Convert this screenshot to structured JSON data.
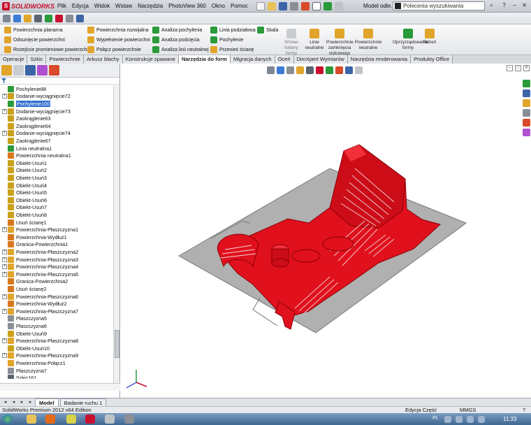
{
  "app": {
    "logo_text": "SOLIDWORKS",
    "document_name": "Model odle...",
    "search_placeholder": "Polecenia wyszukiwania"
  },
  "menu": [
    "Plik",
    "Edycja",
    "Widok",
    "Wstaw",
    "Narzędzia",
    "PhotoView 360",
    "Okno",
    "Pomoc"
  ],
  "ribbon": {
    "col1": [
      "Powierzchnia planarna",
      "Odsunięcie powierzchni",
      "Rozejście promieniowe powierzchni"
    ],
    "col2": [
      "Powierzchnia rozwijalna",
      "Wypełnienie powierzchni",
      "Połącz powierzchnie"
    ],
    "col3": [
      "Analiza pochylenia",
      "Analiza podcięcia",
      "Analiza linii neutralnej"
    ],
    "col4": [
      "Linia podziałowa",
      "Pochylenie",
      "Przenieś ścianę"
    ],
    "skala": "Skala",
    "big": [
      {
        "label": "Wstaw foldery formy"
      },
      {
        "label": "Linie neutralne"
      },
      {
        "label": "Powierzchnie zamknięcia stykowego"
      },
      {
        "label": "Powierzchnie neutralne"
      },
      {
        "label": "Oprzyrządowanie formy"
      },
      {
        "label": "Rdzeń"
      }
    ]
  },
  "tabs": [
    "Operacje",
    "Szkic",
    "Powierzchnie",
    "Arkusz blachy",
    "Konstrukcje spawane",
    "Narzędzia do form",
    "Migracja danych",
    "Oceń",
    "DimXpert Wymiarów",
    "Narzędzia renderowania",
    "Produkty Office"
  ],
  "active_tab_index": 5,
  "tree": [
    {
      "label": "Pochylenie88",
      "expandable": false,
      "icon": "draft-icon",
      "color": "#2a9a3a"
    },
    {
      "label": "Dodanie-wyciągnięcie72",
      "expandable": true,
      "icon": "extrude-icon",
      "color": "#c9a11a"
    },
    {
      "label": "Pochylenie100",
      "expandable": false,
      "icon": "draft-icon",
      "color": "#2a9a3a",
      "selected": true
    },
    {
      "label": "Dodanie-wyciągnięcie73",
      "expandable": true,
      "icon": "extrude-icon",
      "color": "#c9a11a"
    },
    {
      "label": "Zaokrąglenie63",
      "expandable": false,
      "icon": "fillet-icon",
      "color": "#c9a11a"
    },
    {
      "label": "Zaokrąglenie64",
      "expandable": false,
      "icon": "fillet-icon",
      "color": "#c9a11a"
    },
    {
      "label": "Dodanie-wyciągnięcie74",
      "expandable": true,
      "icon": "extrude-icon",
      "color": "#c9a11a"
    },
    {
      "label": "Zaokrąglenie67",
      "expandable": false,
      "icon": "fillet-icon",
      "color": "#c9a11a"
    },
    {
      "label": "Linia neutralna1",
      "expandable": false,
      "icon": "parting-line-icon",
      "color": "#2a9a3a"
    },
    {
      "label": "Powierzchnia neutralna1",
      "expandable": false,
      "icon": "parting-surface-icon",
      "color": "#d9771c"
    },
    {
      "label": "Obiekt-Usuń1",
      "expandable": false,
      "icon": "delete-body-icon",
      "color": "#c9a11a"
    },
    {
      "label": "Obiekt-Usuń2",
      "expandable": false,
      "icon": "delete-body-icon",
      "color": "#c9a11a"
    },
    {
      "label": "Obiekt-Usuń3",
      "expandable": false,
      "icon": "delete-body-icon",
      "color": "#c9a11a"
    },
    {
      "label": "Obiekt-Usuń4",
      "expandable": false,
      "icon": "delete-body-icon",
      "color": "#c9a11a"
    },
    {
      "label": "Obiekt-Usuń5",
      "expandable": false,
      "icon": "delete-body-icon",
      "color": "#c9a11a"
    },
    {
      "label": "Obiekt-Usuń6",
      "expandable": false,
      "icon": "delete-body-icon",
      "color": "#c9a11a"
    },
    {
      "label": "Obiekt-Usuń7",
      "expandable": false,
      "icon": "delete-body-icon",
      "color": "#c9a11a"
    },
    {
      "label": "Obiekt-Usuń8",
      "expandable": false,
      "icon": "delete-body-icon",
      "color": "#c9a11a"
    },
    {
      "label": "Usuń ścianę1",
      "expandable": false,
      "icon": "delete-face-icon",
      "color": "#d9771c"
    },
    {
      "label": "Powierzchnia-Płaszczyzna1",
      "expandable": true,
      "icon": "planar-surface-icon",
      "color": "#e0a52a"
    },
    {
      "label": "Powierzchnia-Wydłuż1",
      "expandable": false,
      "icon": "extend-surface-icon",
      "color": "#d9771c"
    },
    {
      "label": "Granica-Powierzchnia1",
      "expandable": false,
      "icon": "boundary-surface-icon",
      "color": "#d9771c"
    },
    {
      "label": "Powierzchnia-Płaszczyzna2",
      "expandable": true,
      "icon": "planar-surface-icon",
      "color": "#e0a52a"
    },
    {
      "label": "Powierzchnia-Płaszczyzna3",
      "expandable": true,
      "icon": "planar-surface-icon",
      "color": "#e0a52a"
    },
    {
      "label": "Powierzchnia-Płaszczyzna4",
      "expandable": true,
      "icon": "planar-surface-icon",
      "color": "#e0a52a"
    },
    {
      "label": "Powierzchnia-Płaszczyzna5",
      "expandable": true,
      "icon": "planar-surface-icon",
      "color": "#e0a52a"
    },
    {
      "label": "Granica-Powierzchnia2",
      "expandable": false,
      "icon": "boundary-surface-icon",
      "color": "#d9771c"
    },
    {
      "label": "Usuń ścianę2",
      "expandable": false,
      "icon": "delete-face-icon",
      "color": "#d9771c"
    },
    {
      "label": "Powierzchnia-Płaszczyzna6",
      "expandable": true,
      "icon": "planar-surface-icon",
      "color": "#e0a52a"
    },
    {
      "label": "Powierzchnia-Wydłuż2",
      "expandable": false,
      "icon": "extend-surface-icon",
      "color": "#d9771c"
    },
    {
      "label": "Powierzchnia-Płaszczyzna7",
      "expandable": true,
      "icon": "planar-surface-icon",
      "color": "#e0a52a"
    },
    {
      "label": "Płaszczyzna5",
      "expandable": false,
      "icon": "plane-icon",
      "color": "#8a8f96"
    },
    {
      "label": "Płaszczyzna6",
      "expandable": false,
      "icon": "plane-icon",
      "color": "#8a8f96"
    },
    {
      "label": "Obiekt-Usuń9",
      "expandable": false,
      "icon": "delete-body-icon",
      "color": "#c9a11a"
    },
    {
      "label": "Powierzchnia-Płaszczyzna8",
      "expandable": true,
      "icon": "planar-surface-icon",
      "color": "#e0a52a"
    },
    {
      "label": "Obiekt-Usuń10",
      "expandable": false,
      "icon": "delete-body-icon",
      "color": "#c9a11a"
    },
    {
      "label": "Powierzchnia-Płaszczyzna9",
      "expandable": true,
      "icon": "planar-surface-icon",
      "color": "#e0a52a"
    },
    {
      "label": "Powierzchnia-Połącz1",
      "expandable": false,
      "icon": "knit-surface-icon",
      "color": "#e0a52a"
    },
    {
      "label": "Płaszczyzna7",
      "expandable": false,
      "icon": "plane-icon",
      "color": "#8a8f96"
    },
    {
      "label": "Szkic161",
      "expandable": false,
      "icon": "sketch-icon",
      "color": "#5a6370"
    }
  ],
  "bottom_tabs": [
    "Model",
    "Badanie ruchu 1"
  ],
  "status": {
    "left": "SolidWorks Premium 2012 x64 Edition",
    "mode": "Edycja Część",
    "units": "MMGS"
  },
  "taskbar": {
    "lang": "PL",
    "time": "11:33"
  },
  "colors": {
    "model_red": "#e0101c",
    "parting_plane": "#b0b0b0",
    "selection_blue": "#2f6fd0"
  }
}
